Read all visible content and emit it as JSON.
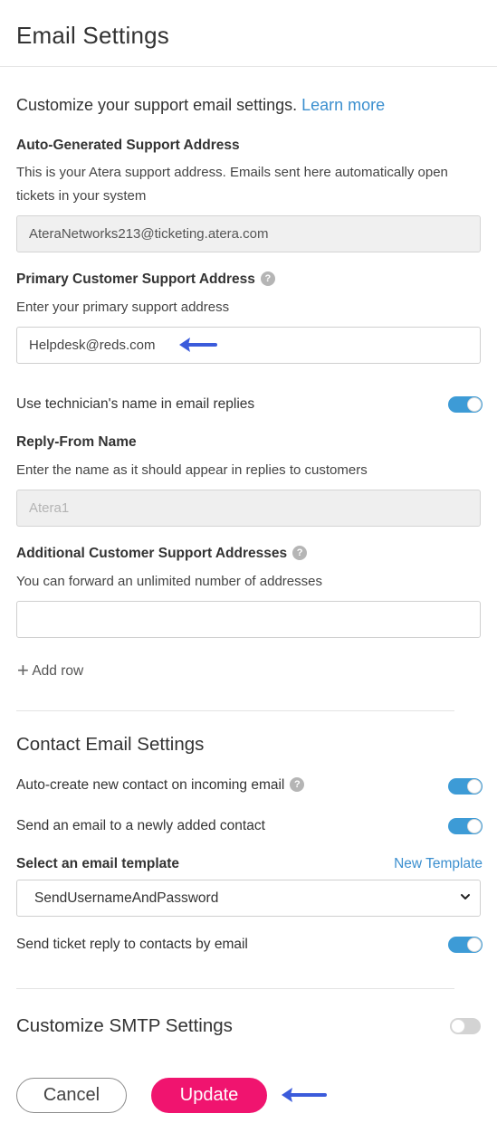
{
  "header": {
    "title": "Email Settings"
  },
  "intro": {
    "text": "Customize your support email settings. ",
    "link": "Learn more"
  },
  "auto_generated": {
    "label": "Auto-Generated Support Address",
    "description": "This is your Atera support address. Emails sent here automatically open tickets in your system",
    "value": "AteraNetworks213@ticketing.atera.com"
  },
  "primary": {
    "label": "Primary Customer Support Address",
    "description": "Enter your primary support address",
    "value": "Helpdesk@reds.com"
  },
  "tech_name": {
    "label": "Use technician's name in email replies",
    "enabled": true
  },
  "reply_from": {
    "label": "Reply-From Name",
    "description": "Enter the name as it should appear in replies to customers",
    "value": "Atera1"
  },
  "additional": {
    "label": "Additional Customer Support Addresses",
    "description": "You can forward an unlimited number of addresses",
    "value": "",
    "add_row_label": "Add row"
  },
  "contact": {
    "title": "Contact Email Settings",
    "auto_create_label": "Auto-create new contact on incoming email",
    "auto_create_enabled": true,
    "send_email_label": "Send an email to a newly added contact",
    "send_email_enabled": true,
    "template_label": "Select an email template",
    "new_template_link": "New Template",
    "template_selected": "SendUsernameAndPassword",
    "reply_label": "Send ticket reply to contacts by email",
    "reply_enabled": true
  },
  "smtp": {
    "title": "Customize SMTP Settings",
    "enabled": false
  },
  "buttons": {
    "cancel": "Cancel",
    "update": "Update"
  },
  "colors": {
    "accent": "#3d9bd6",
    "primary_button": "#f0146f",
    "annotation_arrow": "#3b5bdb"
  }
}
